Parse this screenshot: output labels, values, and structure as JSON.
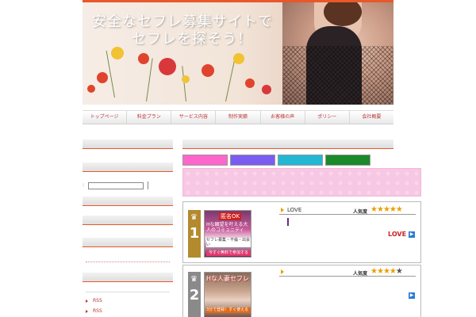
{
  "banner": {
    "title_line1": "安全なセフレ募集サイトで",
    "title_line2": "セフレを探そう！"
  },
  "nav": {
    "items": [
      "トップページ",
      "料金プラン",
      "サービス内容",
      "制作実績",
      "お客様の声",
      "ポリシー",
      "会社概要"
    ]
  },
  "sidebar": {
    "search_colon": ":",
    "rss_links": [
      "RSS",
      "RSS"
    ]
  },
  "main": {
    "color_buttons": [
      "#ff66cc",
      "#7a5cf0",
      "#22b8d4",
      "#1a8a2a"
    ],
    "ranking": [
      {
        "rank": "1",
        "badge_color": "#b38a2e",
        "product_name": "LOVE",
        "popularity_label": "人気度",
        "stars": 5,
        "thumb_text_top": "匿名OK",
        "thumb_text_mid": "Hな願望を叶える大人のコミュニティ",
        "thumb_text_bot": "セフレ募集・不倫・出会い",
        "thumb_cta": "今すぐ無料で参加する",
        "logo_text": "LOVE"
      },
      {
        "rank": "2",
        "badge_color": "#8a8a8a",
        "product_name": "",
        "popularity_label": "人気度",
        "stars": 4,
        "thumb_text_top": "Hな人妻セフレ",
        "thumb_text_mid": "",
        "thumb_text_bot": "3分で登録！すぐ使える",
        "thumb_cta": "",
        "logo_text": ""
      }
    ]
  },
  "icons": {
    "crown": "crown-icon",
    "star": "star-icon",
    "arrow": "arrow-right-icon"
  }
}
